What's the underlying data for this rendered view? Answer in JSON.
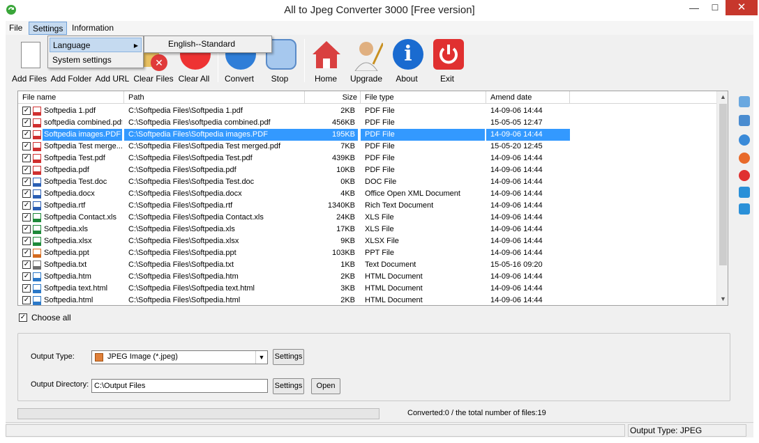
{
  "window": {
    "title": "All to Jpeg Converter 3000 [Free version]",
    "minimize_glyph": "—",
    "maximize_glyph": "☐",
    "close_glyph": "✕"
  },
  "menu": {
    "file": "File",
    "settings": "Settings",
    "information": "Information"
  },
  "settings_menu": {
    "language": "Language",
    "system_settings": "System settings",
    "language_submenu": [
      "English--Standard"
    ]
  },
  "toolbar": [
    {
      "label": "Add Files",
      "icon": "add-files-icon"
    },
    {
      "label": "Add Folder",
      "icon": "add-folder-icon"
    },
    {
      "label": "Add URL",
      "icon": "add-url-icon"
    },
    {
      "label": "Clear Files",
      "icon": "clear-files-icon"
    },
    {
      "label": "Clear All",
      "icon": "clear-all-icon"
    },
    {
      "label": "Convert",
      "icon": "convert-icon"
    },
    {
      "label": "Stop",
      "icon": "stop-icon"
    },
    {
      "label": "Home",
      "icon": "home-icon"
    },
    {
      "label": "Upgrade",
      "icon": "upgrade-icon"
    },
    {
      "label": "About",
      "icon": "about-icon"
    },
    {
      "label": "Exit",
      "icon": "exit-icon"
    }
  ],
  "file_list": {
    "columns": [
      "File name",
      "Path",
      "Size",
      "File type",
      "Amend date"
    ],
    "rows": [
      {
        "name": "Softpedia 1.pdf",
        "path": "C:\\Softpedia Files\\Softpedia 1.pdf",
        "size": "2KB",
        "type": "PDF File",
        "date": "14-09-06 14:44",
        "icon": "pdf"
      },
      {
        "name": "softpedia combined.pdf",
        "path": "C:\\Softpedia Files\\softpedia combined.pdf",
        "size": "456KB",
        "type": "PDF File",
        "date": "15-05-05 12:47",
        "icon": "pdf"
      },
      {
        "name": "Softpedia images.PDF",
        "path": "C:\\Softpedia Files\\Softpedia images.PDF",
        "size": "195KB",
        "type": "PDF File",
        "date": "14-09-06 14:44",
        "icon": "pdf"
      },
      {
        "name": "Softpedia Test merge...",
        "path": "C:\\Softpedia Files\\Softpedia Test merged.pdf",
        "size": "7KB",
        "type": "PDF File",
        "date": "15-05-20 12:45",
        "icon": "pdf"
      },
      {
        "name": "Softpedia Test.pdf",
        "path": "C:\\Softpedia Files\\Softpedia Test.pdf",
        "size": "439KB",
        "type": "PDF File",
        "date": "14-09-06 14:44",
        "icon": "pdf"
      },
      {
        "name": "Softpedia.pdf",
        "path": "C:\\Softpedia Files\\Softpedia.pdf",
        "size": "10KB",
        "type": "PDF File",
        "date": "14-09-06 14:44",
        "icon": "pdf"
      },
      {
        "name": "Softpedia Test.doc",
        "path": "C:\\Softpedia Files\\Softpedia Test.doc",
        "size": "0KB",
        "type": "DOC File",
        "date": "14-09-06 14:44",
        "icon": "doc"
      },
      {
        "name": "Softpedia.docx",
        "path": "C:\\Softpedia Files\\Softpedia.docx",
        "size": "4KB",
        "type": "Office Open XML Document",
        "date": "14-09-06 14:44",
        "icon": "doc"
      },
      {
        "name": "Softpedia.rtf",
        "path": "C:\\Softpedia Files\\Softpedia.rtf",
        "size": "1340KB",
        "type": "Rich Text Document",
        "date": "14-09-06 14:44",
        "icon": "doc"
      },
      {
        "name": "Softpedia Contact.xls",
        "path": "C:\\Softpedia Files\\Softpedia Contact.xls",
        "size": "24KB",
        "type": "XLS File",
        "date": "14-09-06 14:44",
        "icon": "xls"
      },
      {
        "name": "Softpedia.xls",
        "path": "C:\\Softpedia Files\\Softpedia.xls",
        "size": "17KB",
        "type": "XLS File",
        "date": "14-09-06 14:44",
        "icon": "xls"
      },
      {
        "name": "Softpedia.xlsx",
        "path": "C:\\Softpedia Files\\Softpedia.xlsx",
        "size": "9KB",
        "type": "XLSX File",
        "date": "14-09-06 14:44",
        "icon": "xls"
      },
      {
        "name": "Softpedia.ppt",
        "path": "C:\\Softpedia Files\\Softpedia.ppt",
        "size": "103KB",
        "type": "PPT File",
        "date": "14-09-06 14:44",
        "icon": "ppt"
      },
      {
        "name": "Softpedia.txt",
        "path": "C:\\Softpedia Files\\Softpedia.txt",
        "size": "1KB",
        "type": "Text Document",
        "date": "15-05-16 09:20",
        "icon": "txt"
      },
      {
        "name": "Softpedia.htm",
        "path": "C:\\Softpedia Files\\Softpedia.htm",
        "size": "2KB",
        "type": "HTML Document",
        "date": "14-09-06 14:44",
        "icon": "html"
      },
      {
        "name": "Softpedia text.html",
        "path": "C:\\Softpedia Files\\Softpedia text.html",
        "size": "3KB",
        "type": "HTML Document",
        "date": "14-09-06 14:44",
        "icon": "html"
      },
      {
        "name": "Softpedia.html",
        "path": "C:\\Softpedia Files\\Softpedia.html",
        "size": "2KB",
        "type": "HTML Document",
        "date": "14-09-06 14:44",
        "icon": "html"
      }
    ],
    "selected_row": 2,
    "check_glyph": "✓"
  },
  "choose_all": "Choose all",
  "output": {
    "type_label": "Output Type:",
    "type_value": "JPEG Image (*.jpeg)",
    "settings_button": "Settings",
    "dir_label": "Output Directory:",
    "dir_value": "C:\\Output Files",
    "dir_settings_button": "Settings",
    "open_button": "Open"
  },
  "progress": {
    "value": 0
  },
  "converted_text": "Converted:0  /  the total number of files:19",
  "status": {
    "output_type": "Output Type: JPEG"
  },
  "colors": {
    "selection": "#3399ff",
    "close_button": "#c7372c"
  },
  "icons": {
    "pdf": "#d03030",
    "doc": "#2b5fb4",
    "xls": "#1e8a3a",
    "ppt": "#d46a1e",
    "txt": "#707070",
    "html": "#2b78c8"
  }
}
